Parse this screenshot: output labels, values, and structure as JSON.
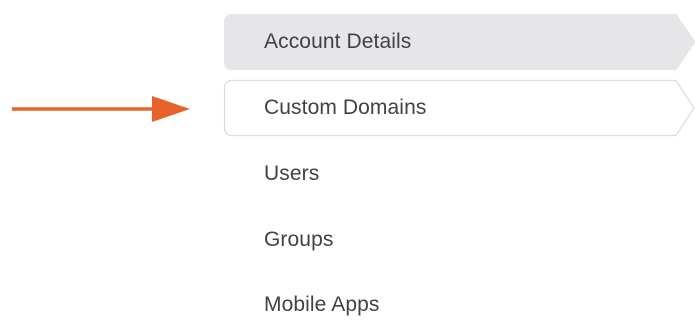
{
  "settings_nav": {
    "items": [
      {
        "label": "Account Details",
        "state": "hover"
      },
      {
        "label": "Custom Domains",
        "state": "selected"
      },
      {
        "label": "Users",
        "state": "normal"
      },
      {
        "label": "Groups",
        "state": "normal"
      },
      {
        "label": "Mobile Apps",
        "state": "normal"
      }
    ]
  },
  "annotation": {
    "arrow_color": "#e8632a",
    "arrow_direction": "right",
    "points_to": "Custom Domains"
  },
  "colors": {
    "hover_fill": "#e6e6e9",
    "selected_fill": "#ffffff",
    "selected_border": "#dcdce0",
    "text": "#3f4247"
  }
}
